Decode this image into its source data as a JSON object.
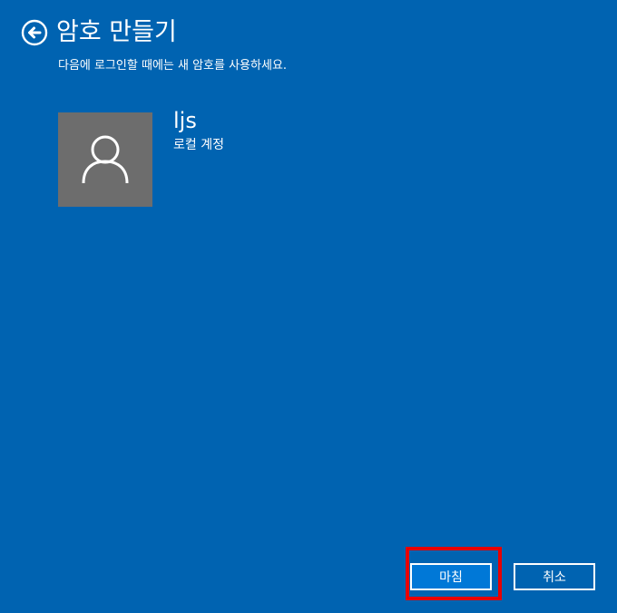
{
  "header": {
    "title": "암호 만들기",
    "back_icon": "back-arrow-circle-icon"
  },
  "subtitle": "다음에 로그인할 때에는 새 암호를 사용하세요.",
  "user": {
    "name": "ljs",
    "account_type": "로컬 계정",
    "avatar_icon": "user-silhouette-icon"
  },
  "buttons": {
    "finish_label": "마침",
    "cancel_label": "취소"
  },
  "colors": {
    "background": "#0063b1",
    "avatar_bg": "#6d6d6d",
    "highlight": "#e80000"
  }
}
